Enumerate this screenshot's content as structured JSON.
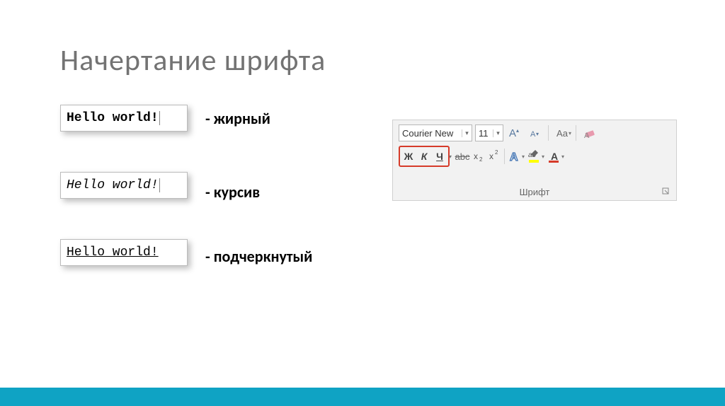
{
  "title": "Начертание шрифта",
  "examples": {
    "bold": {
      "text": "Hello world!",
      "label": "- жирный"
    },
    "italic": {
      "text": "Hello world!",
      "label": "- курсив"
    },
    "underline": {
      "text": "Hello world!",
      "label": "- подчеркнутый"
    }
  },
  "ribbon": {
    "group_label": "Шрифт",
    "font_name": "Courier New",
    "font_size": "11",
    "buttons": {
      "bold": "Ж",
      "italic": "К",
      "underline": "Ч",
      "strike": "abc",
      "subscript_base": "x",
      "subscript_s": "2",
      "superscript_base": "x",
      "superscript_s": "2",
      "text_effect": "A",
      "change_case": "Aa",
      "font_color": "A",
      "highlight_glyph": "ab"
    },
    "icons": {
      "grow_font": "A",
      "shrink_font": "A",
      "eraser": "◢"
    }
  }
}
